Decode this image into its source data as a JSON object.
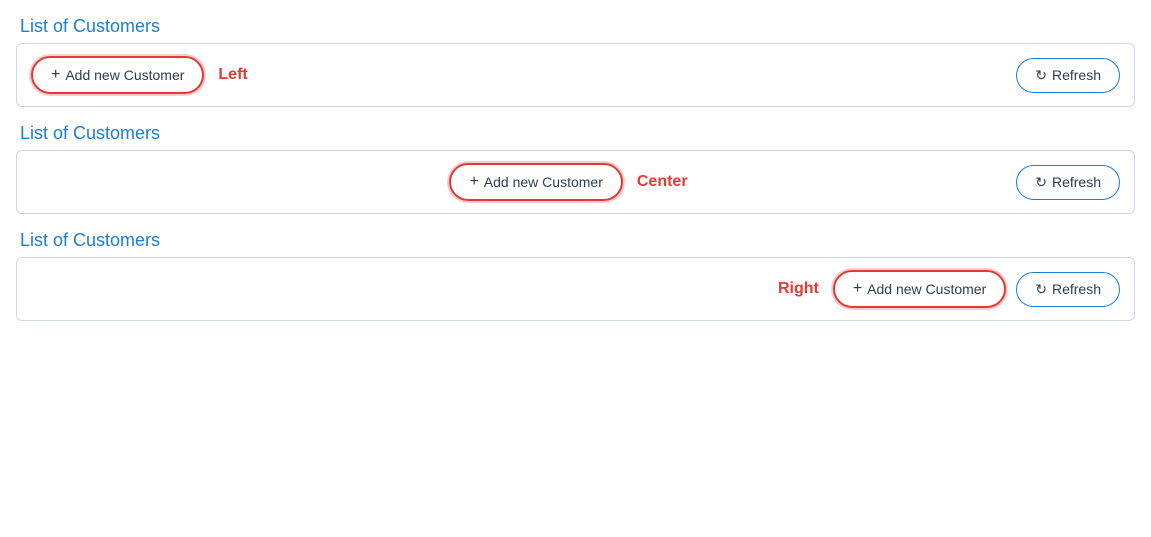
{
  "sections": [
    {
      "id": "section-left",
      "title": "List of Customers",
      "alignment": "left",
      "position_label": "Left",
      "add_button_label": "Add new Customer",
      "refresh_button_label": "Refresh",
      "highlighted": true
    },
    {
      "id": "section-center",
      "title": "List of Customers",
      "alignment": "center",
      "position_label": "Center",
      "add_button_label": "Add new Customer",
      "refresh_button_label": "Refresh",
      "highlighted": true
    },
    {
      "id": "section-right",
      "title": "List of Customers",
      "alignment": "right",
      "position_label": "Right",
      "add_button_label": "Add new Customer",
      "refresh_button_label": "Refresh",
      "highlighted": true
    }
  ],
  "icons": {
    "plus": "+",
    "refresh": "↻"
  }
}
